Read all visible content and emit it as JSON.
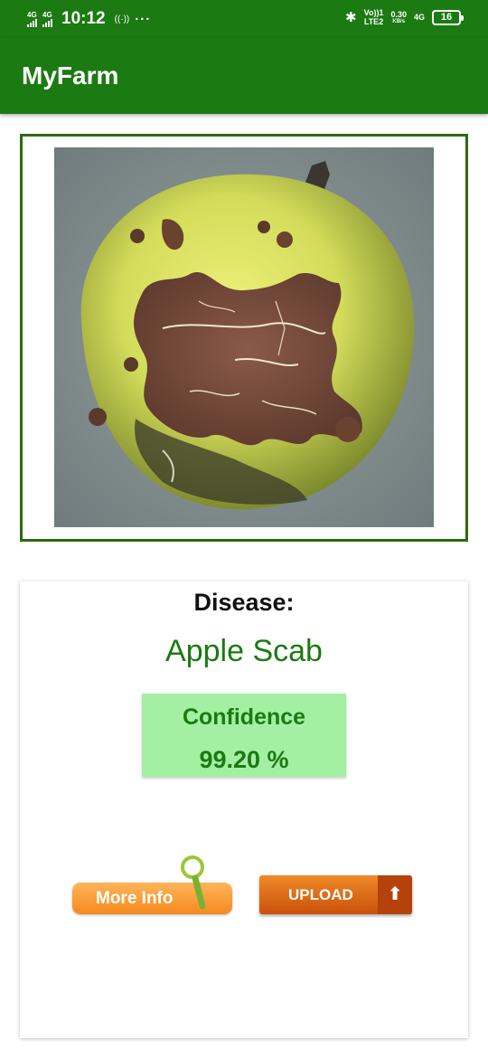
{
  "status_bar": {
    "net1": "4G",
    "net2": "4G",
    "time": "10:12",
    "hotspot": "((·))",
    "dots": "···",
    "bluetooth": "✱",
    "volte_top": "Vo))1",
    "volte_bottom": "LTE2",
    "speed_value": "0.30",
    "speed_unit": "KB/s",
    "net3": "4G",
    "battery": "16"
  },
  "app_bar": {
    "title": "MyFarm"
  },
  "result": {
    "disease_label": "Disease:",
    "disease_name": "Apple Scab",
    "confidence_label": "Confidence",
    "confidence_value": "99.20 %"
  },
  "buttons": {
    "more_info": "More Info",
    "upload": "UPLOAD",
    "upload_icon": "⬆"
  },
  "icons": [
    "bluetooth-icon",
    "battery-icon",
    "signal-icon",
    "magnifier-icon",
    "upload-arrow-icon"
  ],
  "colors": {
    "primary": "#1b7a12",
    "confidence_bg": "#a3f0a3",
    "upload": "#d9620f",
    "more_info": "#f58a1f"
  }
}
